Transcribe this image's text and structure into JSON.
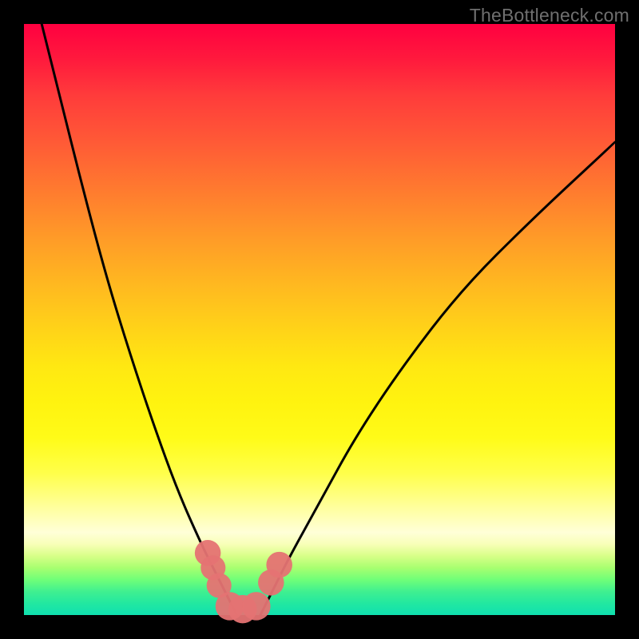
{
  "watermark": "TheBottleneck.com",
  "colors": {
    "frame": "#000000",
    "watermark_text": "#6f6f6f",
    "curve_stroke": "#000000",
    "markers_fill": "#e57373",
    "gradient_stops": [
      "#ff0040",
      "#ff7a2f",
      "#ffe812",
      "#ffffd8",
      "#40f090",
      "#10e0b0"
    ]
  },
  "chart_data": {
    "type": "line",
    "title": "",
    "xlabel": "",
    "ylabel": "",
    "xlim": [
      0,
      100
    ],
    "ylim": [
      0,
      100
    ],
    "annotations": [
      "TheBottleneck.com"
    ],
    "series": [
      {
        "name": "left-curve",
        "x": [
          3,
          6,
          10,
          14,
          18,
          22,
          26,
          30,
          32,
          34,
          36
        ],
        "y": [
          100,
          88,
          72,
          57,
          44,
          32,
          21,
          12,
          8,
          4,
          0
        ]
      },
      {
        "name": "right-curve",
        "x": [
          40,
          42,
          45,
          50,
          56,
          64,
          74,
          86,
          100
        ],
        "y": [
          0,
          4,
          10,
          19,
          30,
          42,
          55,
          67,
          80
        ]
      }
    ],
    "markers": [
      {
        "name": "left-marker-upper",
        "x": 31.1,
        "y": 10.5,
        "r": 2.2
      },
      {
        "name": "left-marker-mid",
        "x": 32.0,
        "y": 8.0,
        "r": 2.1
      },
      {
        "name": "left-marker-lower",
        "x": 33.0,
        "y": 5.0,
        "r": 2.1
      },
      {
        "name": "valley-left",
        "x": 34.8,
        "y": 1.5,
        "r": 2.4
      },
      {
        "name": "valley-mid",
        "x": 37.0,
        "y": 1.0,
        "r": 2.4
      },
      {
        "name": "valley-right",
        "x": 39.3,
        "y": 1.5,
        "r": 2.4
      },
      {
        "name": "right-marker-lower",
        "x": 41.8,
        "y": 5.5,
        "r": 2.2
      },
      {
        "name": "right-marker-upper",
        "x": 43.2,
        "y": 8.5,
        "r": 2.2
      }
    ]
  }
}
